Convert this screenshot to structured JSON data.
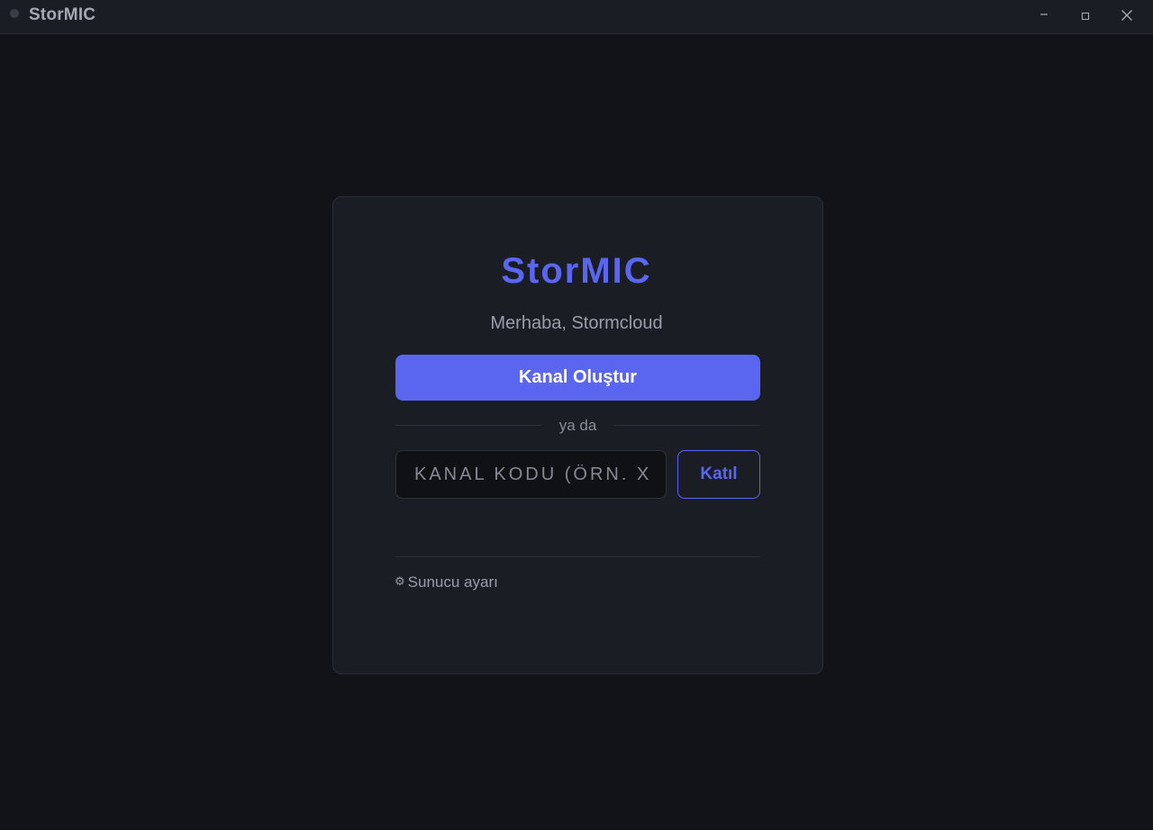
{
  "window": {
    "title": "StorMIC",
    "minimize_icon": "minimize-icon",
    "maximize_icon": "maximize-icon",
    "close_icon": "close-icon"
  },
  "card": {
    "brand": "StorMIC",
    "greeting": "Merhaba, Stormcloud",
    "create_button": "Kanal Oluştur",
    "divider_text": "ya da",
    "code_input": {
      "value": "",
      "placeholder": "Kanal kodu (örn. X"
    },
    "join_button": "Katıl",
    "server_settings": {
      "icon": "⚙",
      "label": "Sunucu ayarı"
    }
  },
  "colors": {
    "accent": "#5b66f0",
    "background": "#111318",
    "card": "#1b1d25"
  }
}
